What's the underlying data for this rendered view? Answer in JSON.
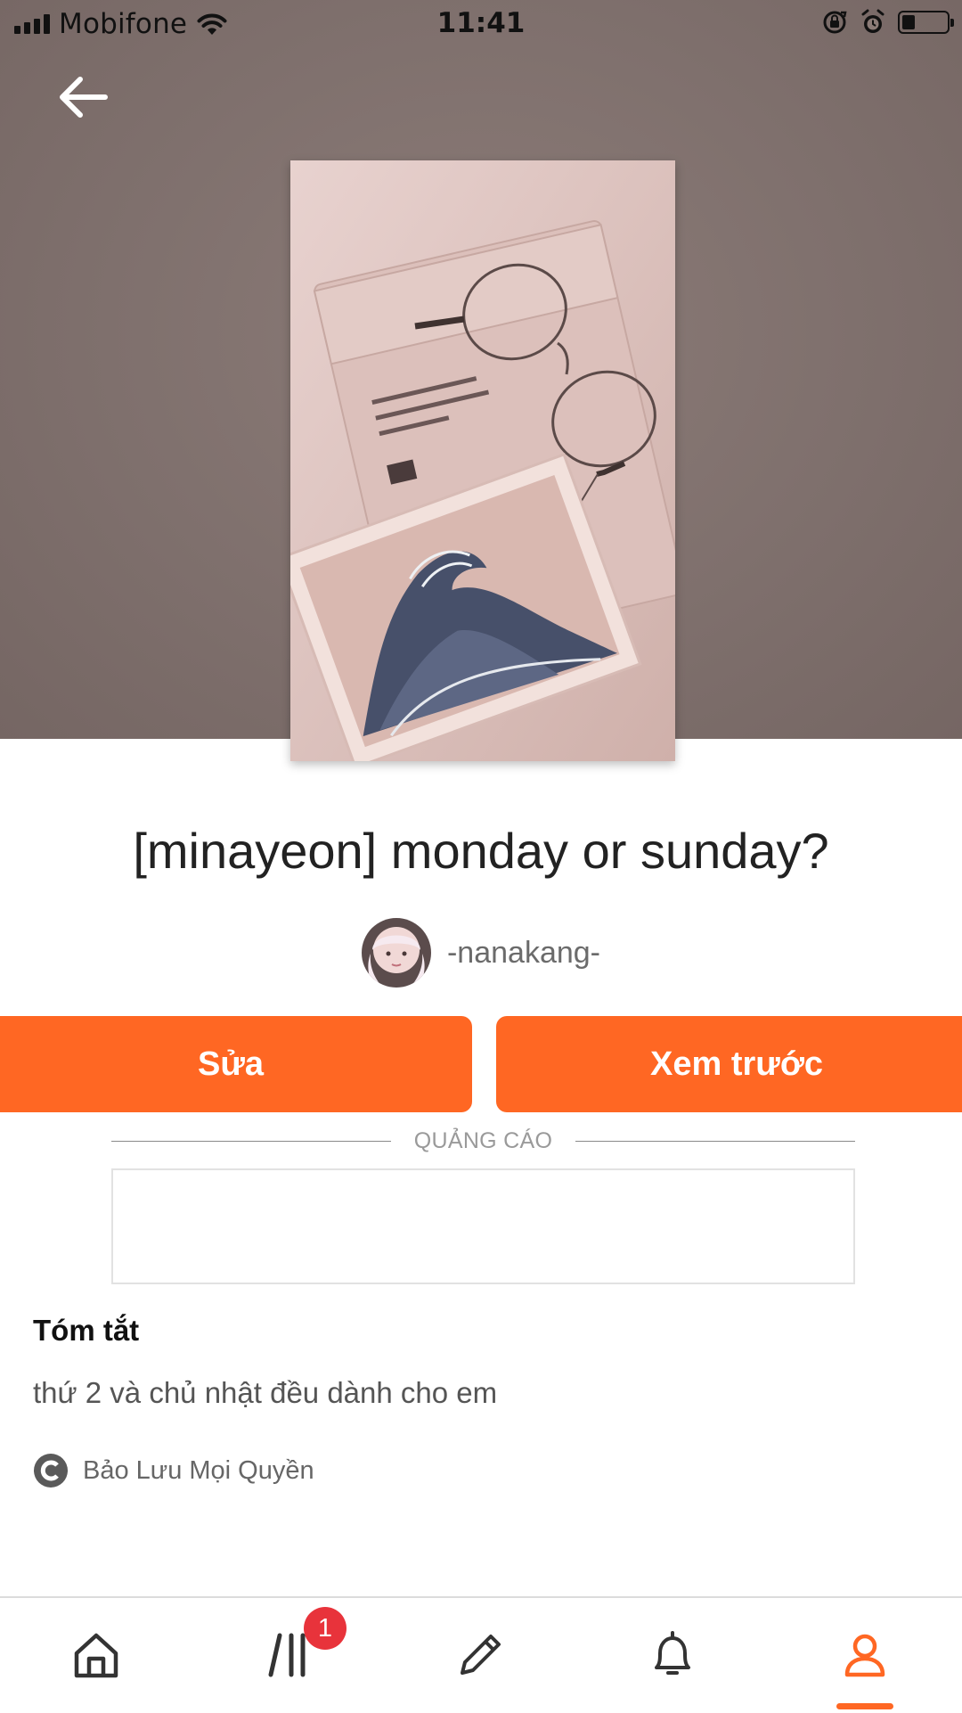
{
  "status_bar": {
    "carrier": "Mobifone",
    "time": "11:41",
    "battery_level": 0.3
  },
  "header": {
    "back_icon": "arrow-left-icon"
  },
  "story": {
    "cover_image": "book-cover-image",
    "title": "[minayeon] monday or sunday?",
    "author": "-nanakang-"
  },
  "actions": {
    "edit_label": "Sửa",
    "preview_label": "Xem trước"
  },
  "ad": {
    "label": "QUẢNG CÁO"
  },
  "summary": {
    "heading": "Tóm tắt",
    "text": "thứ 2 và chủ nhật đều dành cho em",
    "copyright_icon": "copyright-icon",
    "copyright": "Bảo Lưu Mọi Quyền"
  },
  "bottom_nav": {
    "items": [
      {
        "icon": "home-icon"
      },
      {
        "icon": "library-icon",
        "badge": "1"
      },
      {
        "icon": "pencil-icon"
      },
      {
        "icon": "bell-icon"
      },
      {
        "icon": "profile-icon",
        "active": true
      }
    ]
  },
  "colors": {
    "accent": "#ff6723",
    "badge": "#e8333b",
    "hero_background": "#7f706d"
  }
}
